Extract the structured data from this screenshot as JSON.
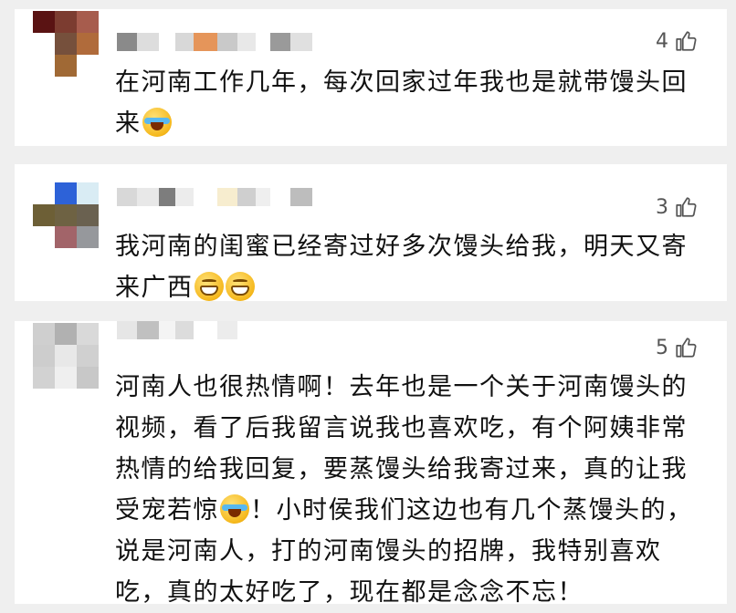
{
  "comments": [
    {
      "likes": "4",
      "text_before": "在河南工作几年，每次回家过年我也是就带馒头回来",
      "emojis": [
        "cry"
      ],
      "text_after": "",
      "avatar_colors": [
        "#5a1313",
        "#7c3c30",
        "#a75c4d",
        "#ffffff",
        "#76503c",
        "#b06b3b",
        "#ffffff",
        "#a06935",
        "#ffffff"
      ],
      "name_colors": [
        "#8a8a8a",
        "#dddddd",
        "#ffffff",
        "#d8d8d8",
        "#e5955a",
        "#c9c9c9",
        "#e8e8e8",
        "#ffffff",
        "#9a9a9a",
        "#e0e0e0"
      ]
    },
    {
      "likes": "3",
      "text_before": "我河南的闺蜜已经寄过好多次馒头给我，明天又寄来广西",
      "emojis": [
        "grin",
        "grin"
      ],
      "text_after": "",
      "avatar_colors": [
        "#ffffff",
        "#2d62d8",
        "#d9ecf4",
        "#6d5f36",
        "#6e6243",
        "#6a6150",
        "#ffffff",
        "#a26469",
        "#96989c"
      ],
      "name_colors": [
        "#d8d8d8",
        "#e8e8e8",
        "#7d7d7d",
        "#ececec",
        "#ffffff",
        "#f7edcf",
        "#cfcfcf",
        "#efefef",
        "#ffffff",
        "#bdbdbd"
      ]
    },
    {
      "likes": "5",
      "text_before": "河南人也很热情啊！去年也是一个关于河南馒头的视频，看了后我留言说我也喜欢吃，有个阿姨非常热情的给我回复，要蒸馒头给我寄过来，真的让我受宠若惊",
      "emojis": [
        "cry"
      ],
      "text_after": "！小时侯我们这边也有几个蒸馒头的，说是河南人，打的河南馒头的招牌，我特别喜欢吃，真的太好吃了，现在都是念念不忘！",
      "avatar_colors": [
        "#cfcfcf",
        "#b1b1b1",
        "#d9d9d9",
        "#cdcdcd",
        "#e8e8e8",
        "#d0d0d0",
        "#d2d2d2",
        "#efefef",
        "#c8c8c8"
      ],
      "name_colors": [
        "#e6e6e6",
        "#c0c0c0",
        "#f4f4f4",
        "#dcdcdc",
        "#ffffff",
        "#ececec"
      ]
    }
  ]
}
